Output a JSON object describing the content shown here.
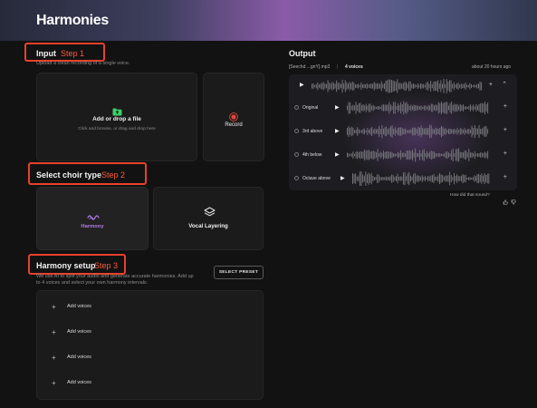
{
  "app": {
    "title": "Harmonies"
  },
  "input": {
    "title": "Input",
    "step": "Step 1",
    "description": "Upload a clean recording of a single voice.",
    "upload_title": "Add or drop a file",
    "upload_sub": "Click and browse, or drag and drop here",
    "record_label": "Record"
  },
  "choir": {
    "title": "Select choir type",
    "step": "Step 2",
    "options": [
      {
        "label": "Harmony",
        "selected": true
      },
      {
        "label": "Vocal Layering",
        "selected": false
      }
    ]
  },
  "harmony_setup": {
    "title": "Harmony setup",
    "step": "Step 3",
    "description_line1": "We use AI to split your audio and generate accurate harmonies. Add up",
    "description_line2": "to 4 voices and select your own harmony intervals.",
    "select_preset_label": "SELECT PRESET",
    "voices": [
      "Add voices",
      "Add voices",
      "Add voices",
      "Add voices"
    ]
  },
  "output": {
    "title": "Output",
    "file_name": "[Seechd ...gnY].mp3",
    "voice_count": "4 voices",
    "timestamp": "about 20 hours ago",
    "tracks": [
      {
        "label": "Original"
      },
      {
        "label": "3rd above"
      },
      {
        "label": "4th below"
      },
      {
        "label": "Octave above"
      }
    ],
    "feedback_question": "How did that sound?"
  },
  "colors": {
    "accent_red": "#e8412b",
    "harmony_purple": "#b27be8",
    "upload_green": "#3ecf6a",
    "record_red": "#e0463a"
  }
}
